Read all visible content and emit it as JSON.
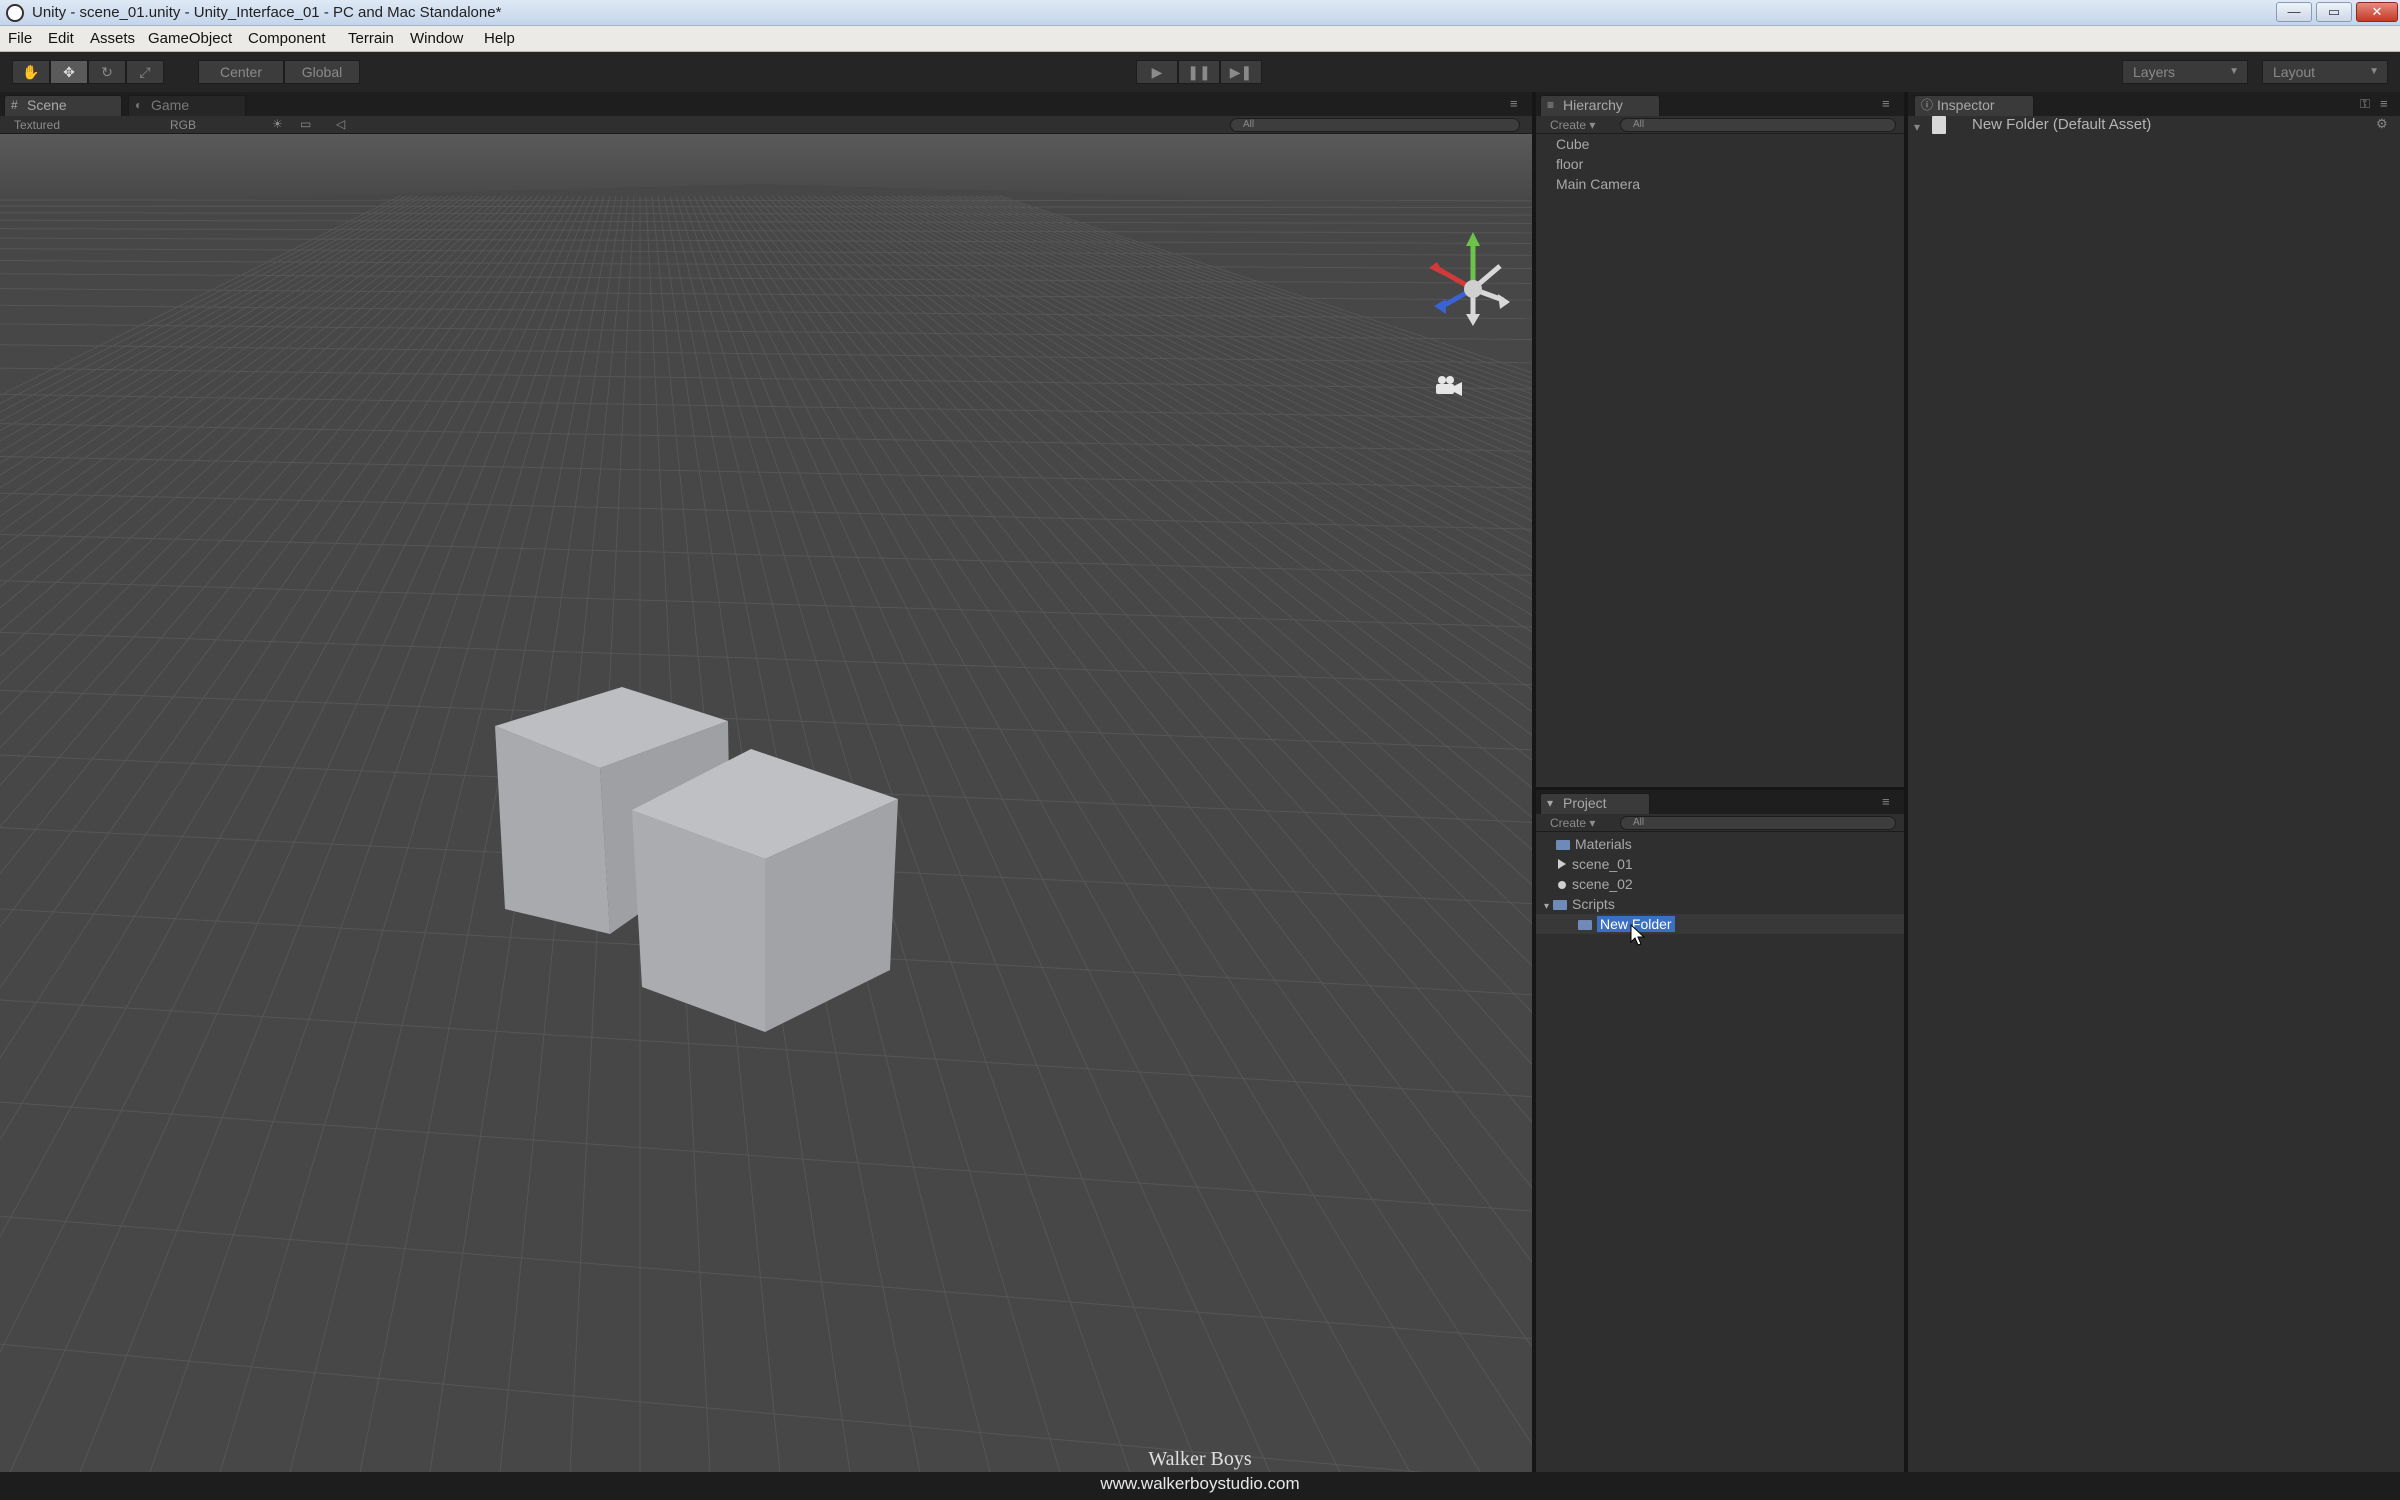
{
  "window": {
    "title": "Unity - scene_01.unity - Unity_Interface_01 - PC and Mac Standalone*",
    "buttons": {
      "minimize": "—",
      "maximize": "▭",
      "close": "✕"
    }
  },
  "menu": [
    "File",
    "Edit",
    "Assets",
    "GameObject",
    "Component",
    "Terrain",
    "Window",
    "Help"
  ],
  "toolbar": {
    "transform_tools": [
      "✋",
      "✥",
      "↻",
      "⤢"
    ],
    "pivot": "Center",
    "space": "Global",
    "play": "▶",
    "pause": "❚❚",
    "step": "▶❚",
    "layers": "Layers",
    "layout": "Layout"
  },
  "scene_panel": {
    "tabs": [
      "Scene",
      "Game"
    ],
    "render_mode": "Textured",
    "color_mode": "RGB",
    "search_placeholder": "All"
  },
  "hierarchy": {
    "tab": "Hierarchy",
    "create": "Create",
    "search_placeholder": "All",
    "items": [
      "Cube",
      "floor",
      "Main Camera"
    ]
  },
  "project": {
    "tab": "Project",
    "create": "Create",
    "search_placeholder": "All",
    "items": [
      {
        "label": "Materials",
        "icon": "folder-icon"
      },
      {
        "label": "scene_01",
        "icon": "scene-icon"
      },
      {
        "label": "scene_02",
        "icon": "prefab-icon"
      },
      {
        "label": "Scripts",
        "icon": "folder-icon"
      },
      {
        "label": "New Folder",
        "icon": "folder-icon",
        "selected": true
      }
    ]
  },
  "inspector": {
    "tab": "Inspector",
    "object": "New Folder (Default Asset)"
  },
  "watermark": {
    "name": "Walker Boys",
    "url": "www.walkerboystudio.com"
  },
  "colors": {
    "editor_bg": "#2f2f2f",
    "scene_bg": "#4a4a4a",
    "selection": "#3a6fc4",
    "gizmo_x": "#d23a3a",
    "gizmo_y": "#6cc24a",
    "gizmo_z": "#3a62d2"
  }
}
